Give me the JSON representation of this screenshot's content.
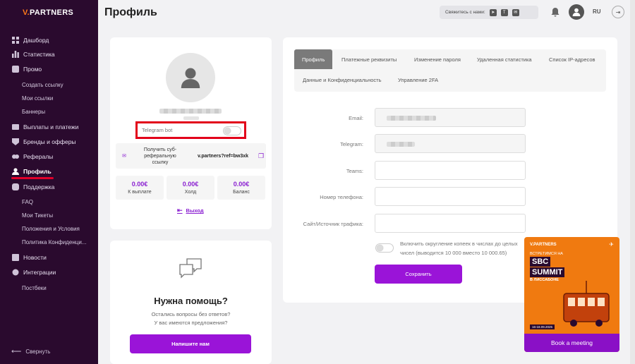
{
  "brand": {
    "logo_v": "V.",
    "logo_rest": "PARTNERS"
  },
  "sidebar": {
    "items": [
      {
        "key": "dashboard",
        "label": "Дашборд"
      },
      {
        "key": "stats",
        "label": "Статистика"
      },
      {
        "key": "promo",
        "label": "Промо"
      },
      {
        "key": "payouts",
        "label": "Выплаты и платежи"
      },
      {
        "key": "brands",
        "label": "Бренды и офферы"
      },
      {
        "key": "referrals",
        "label": "Рефералы"
      },
      {
        "key": "profile",
        "label": "Профиль"
      },
      {
        "key": "support",
        "label": "Поддержка"
      },
      {
        "key": "news",
        "label": "Новости"
      },
      {
        "key": "integrations",
        "label": "Интеграции"
      },
      {
        "key": "postbacks",
        "label": "Постбеки"
      }
    ],
    "promo_sub": [
      "Создать ссылку",
      "Мои ссылки",
      "Баннеры"
    ],
    "support_sub": [
      "FAQ",
      "Мои Тикеты",
      "Положения и Условия",
      "Политика Конфиденци..."
    ],
    "collapse_label": "Свернуть"
  },
  "header": {
    "title": "Профиль",
    "contact_label": "Свяжитесь с нами:",
    "lang": "RU"
  },
  "profile": {
    "telegram_bot_label": "Telegram bot",
    "ref_label": "Получить суб-реферальную ссылку",
    "ref_link": "v.partners?ref=bw3xk",
    "stats": [
      {
        "value": "0.00€",
        "label": "К выплате"
      },
      {
        "value": "0.00€",
        "label": "Холд"
      },
      {
        "value": "0.00€",
        "label": "Баланс"
      }
    ],
    "exit_label": "Выход"
  },
  "help": {
    "title": "Нужна помощь?",
    "line1": "Остались вопросы без ответов?",
    "line2": "У вас имеются предложения?",
    "button": "Напишите нам"
  },
  "tabs": [
    "Профиль",
    "Платежные реквизиты",
    "Изменение пароля",
    "Удаленная статистика",
    "Список IP-адресов",
    "Данные и Конфиденциальность",
    "Управление 2FA"
  ],
  "form": {
    "email_label": "Email:",
    "telegram_label": "Telegram:",
    "teams_label": "Teams:",
    "phone_label": "Номер телефона:",
    "site_label": "Сайт/Источник трафика:",
    "rounding_text": "Включить округление копеек в числах до целых чисел (выводится 10 000 вместо 10 000.65)",
    "save": "Сохранить"
  },
  "promo_banner": {
    "logo": "V.PARTNERS",
    "meet": "ВСТРЕТИМСЯ НА",
    "title1": "SBC",
    "title2": "SUMMIT",
    "city": "В ЛИССАБОНЕ",
    "dates": "16-18.09.2025",
    "button": "Book a meeting"
  },
  "colors": {
    "accent": "#9a14d8",
    "sidebar": "#2a0a2e",
    "highlight": "#e2001a",
    "promo": "#f07a10"
  }
}
